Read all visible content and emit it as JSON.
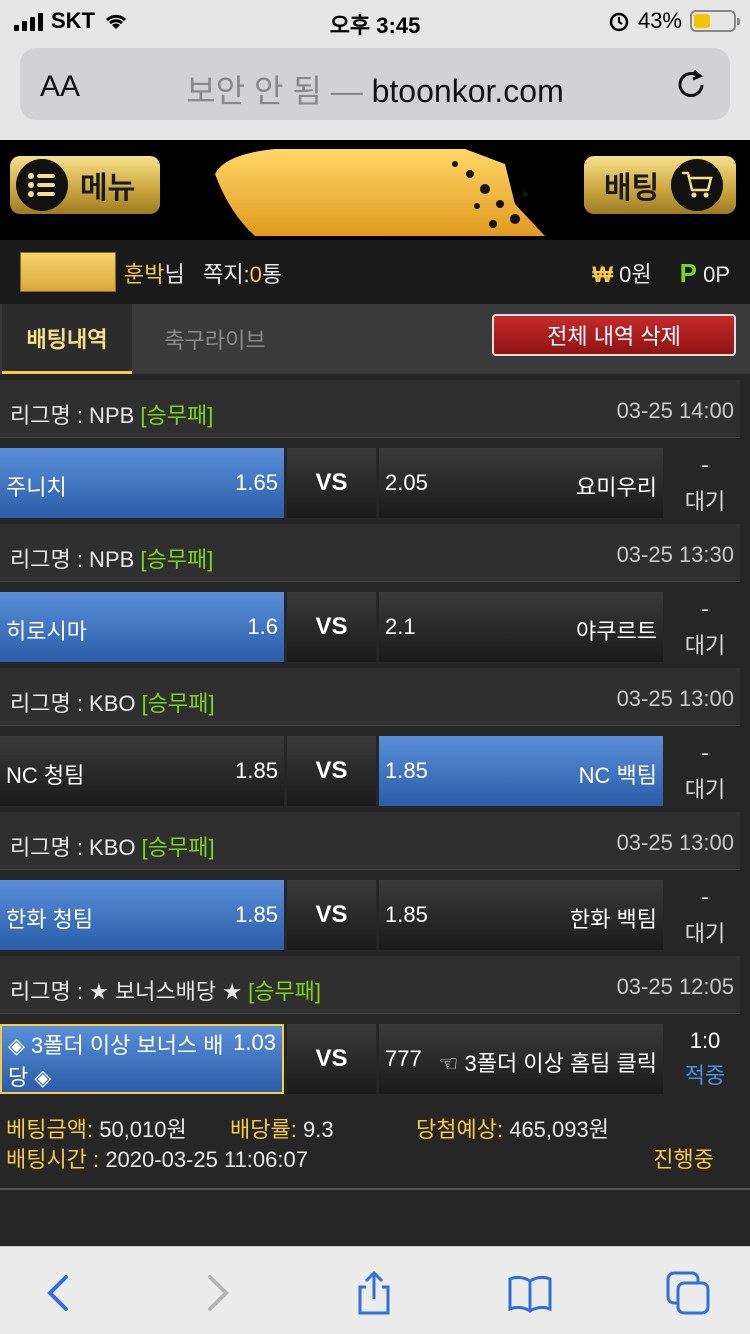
{
  "status_bar": {
    "carrier": "SKT",
    "time": "오후 3:45",
    "battery": "43%"
  },
  "browser": {
    "aa": "AA",
    "insecure_label": "보안 안 됨 —",
    "domain": "btoonkor.com"
  },
  "header": {
    "menu_label": "메뉴",
    "bet_label": "배팅"
  },
  "user": {
    "name": "훈박",
    "suffix": "님",
    "messages_label": "쪽지:",
    "messages_count": "0",
    "messages_unit": "통",
    "won_symbol": "₩",
    "won_amount": "0원",
    "point_symbol": "P",
    "point_amount": "0P"
  },
  "tabs": {
    "active": "배팅내역",
    "inactive": "축구라이브",
    "delete": "전체 내역 삭제"
  },
  "games": [
    {
      "league": "리그명 : NPB",
      "type": "[승무패]",
      "time": "03-25 14:00",
      "home": "주니치",
      "home_odd": "1.65",
      "vs": "VS",
      "away_odd": "2.05",
      "away": "요미우리",
      "dash": "-",
      "state": "대기"
    },
    {
      "league": "리그명 : NPB",
      "type": "[승무패]",
      "time": "03-25 13:30",
      "home": "히로시마",
      "home_odd": "1.6",
      "vs": "VS",
      "away_odd": "2.1",
      "away": "야쿠르트",
      "dash": "-",
      "state": "대기"
    },
    {
      "league": "리그명 : KBO",
      "type": "[승무패]",
      "time": "03-25 13:00",
      "home": "NC 청팀",
      "home_odd": "1.85",
      "vs": "VS",
      "away_odd": "1.85",
      "away": "NC 백팀",
      "dash": "-",
      "state": "대기"
    },
    {
      "league": "리그명 : KBO",
      "type": "[승무패]",
      "time": "03-25 13:00",
      "home": "한화 청팀",
      "home_odd": "1.85",
      "vs": "VS",
      "away_odd": "1.85",
      "away": "한화 백팀",
      "dash": "-",
      "state": "대기"
    },
    {
      "league": "리그명 : ★ 보너스배당 ★",
      "type": "[승무패]",
      "time": "03-25 12:05",
      "home": "◈ 3폴더 이상 보너스 배당 ◈",
      "home_odd": "1.03",
      "vs": "VS",
      "away_odd": "777",
      "away": "☜ 3폴더 이상 홈팀 클릭",
      "score": "1:0",
      "state": "적중"
    }
  ],
  "summary": {
    "amount_label": "베팅금액:",
    "amount": "50,010원",
    "rate_label": "배당률:",
    "rate": "9.3",
    "expected_label": "당첨예상:",
    "expected": "465,093원",
    "time_label": "배팅시간 :",
    "time": "2020-03-25 11:06:07",
    "status": "진행중"
  },
  "colors": {
    "accent_gold": "#f7c948",
    "selected_blue": "#3d74c4",
    "status_green": "#7ed321",
    "hit_blue": "#4a90e2"
  }
}
